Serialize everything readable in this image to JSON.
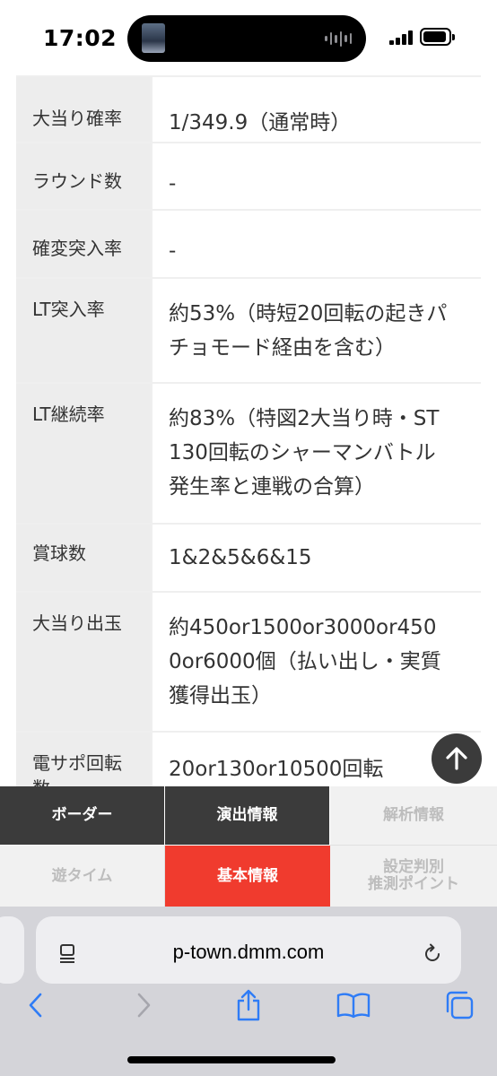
{
  "status_bar": {
    "time": "17:02"
  },
  "spec_table": {
    "rows": [
      {
        "label": "大当り確率",
        "value": "1/349.9（通常時）"
      },
      {
        "label": "ラウンド数",
        "value": "-"
      },
      {
        "label": "確変突入率",
        "value": "-"
      },
      {
        "label": "LT突入率",
        "value": "約53%（時短20回転の起きパ\nチョモード経由を含む）"
      },
      {
        "label": "LT継続率",
        "value": "約83%（特図2大当り時・ST\n130回転のシャーマンバトル\n発生率と連戦の合算）"
      },
      {
        "label": "賞球数",
        "value": "1&2&5&6&15"
      },
      {
        "label": "大当り出玉",
        "value": "約450or1500or3000or450\n0or6000個（払い出し・実質\n獲得出玉）"
      },
      {
        "label": "電サポ回転数",
        "value": "20or130or10500回転"
      }
    ]
  },
  "bottom_nav": {
    "border": "ボーダー",
    "effects": "演出情報",
    "analysis": "解析情報",
    "play_time": "遊タイム",
    "basic": "基本情報",
    "setting_line1": "設定判別",
    "setting_line2": "推測ポイント"
  },
  "browser": {
    "url": "p-town.dmm.com"
  },
  "colors": {
    "active_tab": "#f03b2e",
    "dark_tab": "#3b3b3b",
    "ios_blue": "#2f7cf6"
  }
}
